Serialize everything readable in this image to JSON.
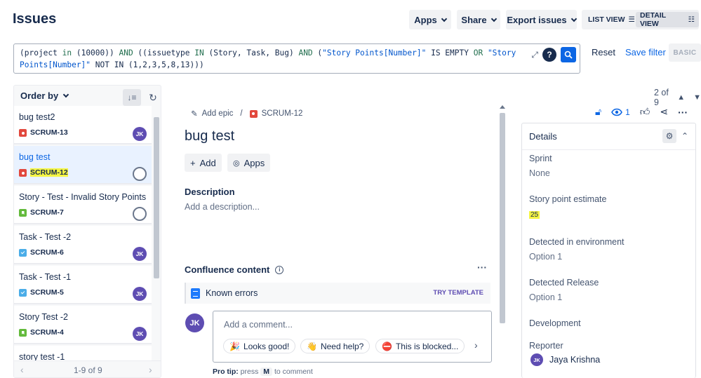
{
  "header": {
    "title": "Issues",
    "apps_label": "Apps",
    "share_label": "Share",
    "export_label": "Export issues",
    "list_view_label": "LIST VIEW",
    "detail_view_label": "DETAIL VIEW"
  },
  "jql": {
    "segments": [
      {
        "t": "(project ",
        "c": ""
      },
      {
        "t": "in",
        "c": "kw"
      },
      {
        "t": " (10000)) ",
        "c": ""
      },
      {
        "t": "AND",
        "c": "kw"
      },
      {
        "t": " ((issuetype ",
        "c": ""
      },
      {
        "t": "IN",
        "c": "kw"
      },
      {
        "t": " (Story, Task, Bug) ",
        "c": ""
      },
      {
        "t": "AND",
        "c": "kw"
      },
      {
        "t": " (",
        "c": ""
      },
      {
        "t": "\"Story Points[Number]\"",
        "c": "str"
      },
      {
        "t": " IS EMPTY ",
        "c": ""
      },
      {
        "t": "OR",
        "c": "kw"
      },
      {
        "t": " ",
        "c": ""
      },
      {
        "t": "\"Story\nPoints[Number]\"",
        "c": "str"
      },
      {
        "t": " NOT IN (1,2,3,5,8,13)))",
        "c": ""
      }
    ],
    "reset_label": "Reset",
    "save_label": "Save filter",
    "basic_label": "BASIC"
  },
  "list": {
    "order_label": "Order by",
    "pager": "1-9 of 9",
    "items": [
      {
        "title": "bug test2",
        "key": "SCRUM-13",
        "type": "bug",
        "avatar": "JK"
      },
      {
        "title": "bug test",
        "key": "SCRUM-12",
        "type": "bug",
        "avatar": "",
        "selected": true
      },
      {
        "title": "Story - Test - Invalid Story Points",
        "key": "SCRUM-7",
        "type": "story",
        "avatar": ""
      },
      {
        "title": "Task - Test -2",
        "key": "SCRUM-6",
        "type": "task",
        "avatar": "JK"
      },
      {
        "title": "Task - Test -1",
        "key": "SCRUM-5",
        "type": "task",
        "avatar": "JK"
      },
      {
        "title": "Story Test -2",
        "key": "SCRUM-4",
        "type": "story",
        "avatar": "JK"
      },
      {
        "title": "story test -1",
        "key": "",
        "type": "story",
        "avatar": ""
      }
    ]
  },
  "issue": {
    "add_epic": "Add epic",
    "key": "SCRUM-12",
    "title": "bug test",
    "add_label": "Add",
    "apps_label": "Apps",
    "description_heading": "Description",
    "description_placeholder": "Add a description...",
    "confluence_heading": "Confluence content",
    "known_errors": "Known errors",
    "try_template": "TRY TEMPLATE",
    "comment_avatar": "JK",
    "comment_placeholder": "Add a comment...",
    "chips": [
      {
        "icon": "🎉",
        "label": "Looks good!"
      },
      {
        "icon": "👋",
        "label": "Need help?"
      },
      {
        "icon": "⛔",
        "label": "This is blocked..."
      }
    ],
    "protip_a": "Pro tip:",
    "protip_b": "press",
    "protip_key": "M",
    "protip_c": "to comment"
  },
  "right": {
    "position": "2 of 9",
    "watchers": "1",
    "details_heading": "Details",
    "fields": [
      {
        "label": "Sprint",
        "value": "None"
      },
      {
        "label": "Story point estimate",
        "value": "25",
        "highlight": true
      },
      {
        "label": "Detected in environment",
        "value": "Option 1"
      },
      {
        "label": "Detected Release",
        "value": "Option 1"
      },
      {
        "label": "Development",
        "value": ""
      },
      {
        "label": "Reporter",
        "value": ""
      }
    ],
    "reporter_initials": "JK",
    "reporter_name": "Jaya Krishna"
  },
  "colors": {
    "accent": "#0c66e4",
    "bug": "#e2483d",
    "story": "#63ba3c",
    "task": "#4bade8",
    "avatar": "#5e4db2",
    "highlight": "#f5f542"
  }
}
